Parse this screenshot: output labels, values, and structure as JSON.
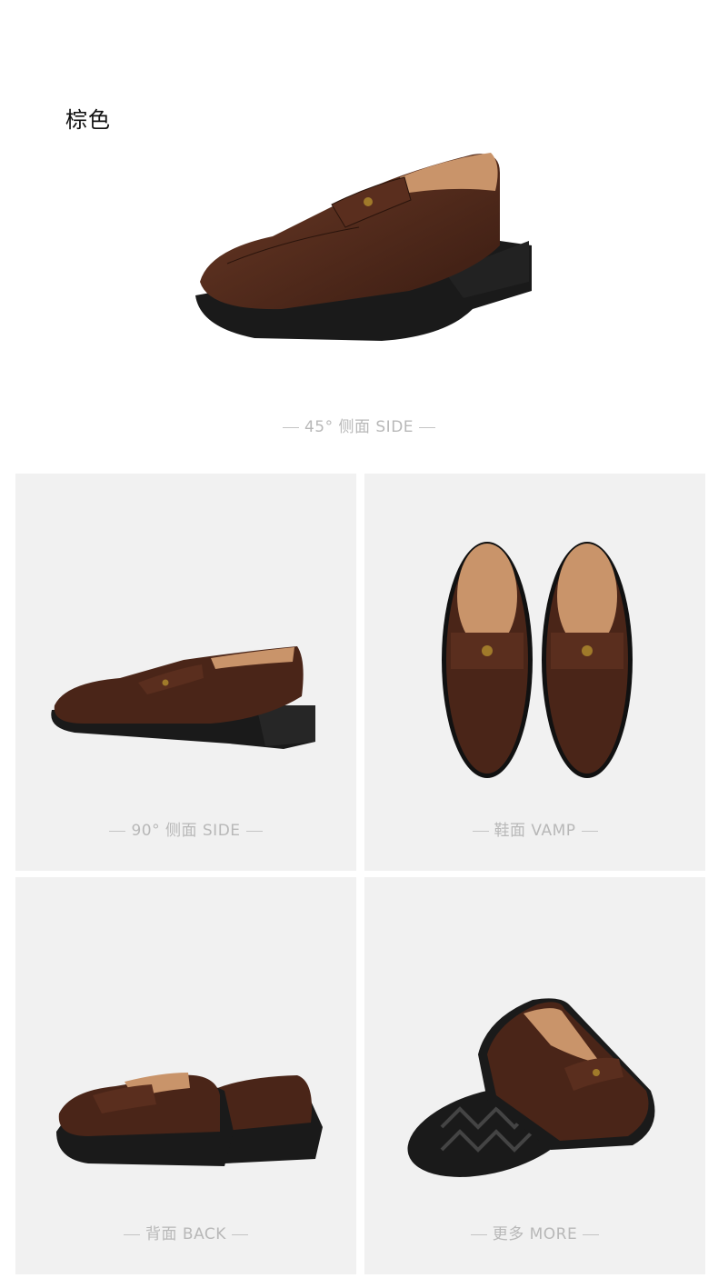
{
  "color_label": "棕色",
  "views": {
    "hero": {
      "caption": "45°  侧面 SIDE"
    },
    "side90": {
      "caption": "90°  侧面 SIDE"
    },
    "vamp": {
      "caption": "鞋面 VAMP"
    },
    "back": {
      "caption": "背面 BACK"
    },
    "more": {
      "caption": "更多 MORE"
    }
  },
  "colors": {
    "leather": "#4a2518",
    "leather_highlight": "#6b3a26",
    "lining": "#c9946a",
    "sole": "#1a1a1a",
    "panel_bg": "#f1f1f1",
    "caption": "#b8b8b8"
  }
}
